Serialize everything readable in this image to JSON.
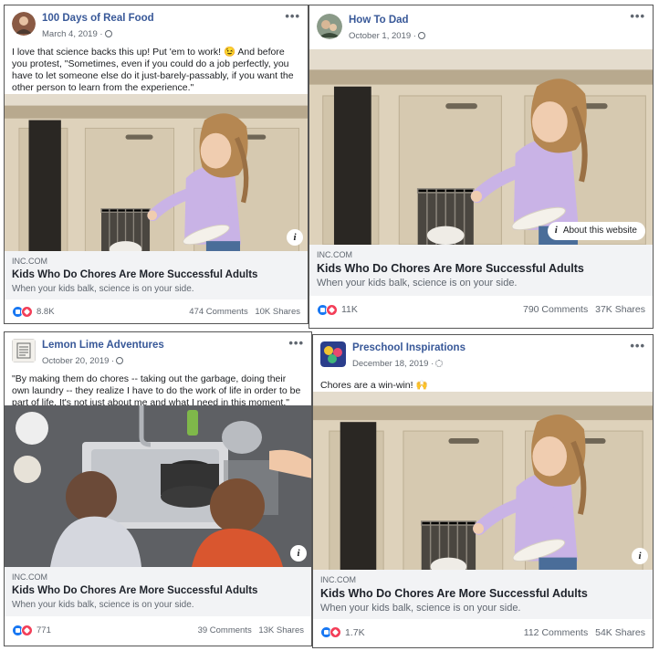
{
  "colors": {
    "page_name": "#385898",
    "link_box": "#f2f3f5",
    "like": "#1877f2",
    "love": "#f33e58"
  },
  "posts": [
    {
      "page_name": "100 Days of Real Food",
      "date": "March 4, 2019 ·",
      "privacy_icon": "globe-icon",
      "caption": "I love that science backs this up! Put 'em to work! 😉 And before you protest, \"Sometimes, even if you could do a job perfectly, you have to let someone else do it just-barely-passably, if you want the other person to learn from the experience.\"",
      "link": {
        "domain": "INC.COM",
        "title": "Kids Who Do Chores Are More Successful Adults",
        "description": "When your kids balk, science is on your side."
      },
      "reactions": "8.8K",
      "comments": "474 Comments",
      "shares": "10K Shares",
      "more_label": "•••"
    },
    {
      "page_name": "How To Dad",
      "date": "October 1, 2019 ·",
      "privacy_icon": "globe-icon",
      "caption": "",
      "about_label": "About this website",
      "link": {
        "domain": "INC.COM",
        "title": "Kids Who Do Chores Are More Successful Adults",
        "description": "When your kids balk, science is on your side."
      },
      "reactions": "11K",
      "comments": "790 Comments",
      "shares": "37K Shares",
      "more_label": "•••"
    },
    {
      "page_name": "Lemon Lime Adventures",
      "date": "October 20, 2019 ·",
      "privacy_icon": "globe-icon",
      "caption": "\"By making them do chores -- taking out the garbage, doing their own laundry -- they realize I have to do the work of life in order to be part of life. It's not just about me and what I need in this moment.\"",
      "link": {
        "domain": "INC.COM",
        "title": "Kids Who Do Chores Are More Successful Adults",
        "description": "When your kids balk, science is on your side."
      },
      "reactions": "771",
      "comments": "39 Comments",
      "shares": "13K Shares",
      "more_label": "•••"
    },
    {
      "page_name": "Preschool Inspirations",
      "date": "December 18, 2019 ·",
      "privacy_icon": "gear-icon",
      "caption": "Chores are a win-win! 🙌",
      "link": {
        "domain": "INC.COM",
        "title": "Kids Who Do Chores Are More Successful Adults",
        "description": "When your kids balk, science is on your side."
      },
      "reactions": "1.7K",
      "comments": "112 Comments",
      "shares": "54K Shares",
      "more_label": "•••"
    }
  ],
  "info_glyph": "i"
}
